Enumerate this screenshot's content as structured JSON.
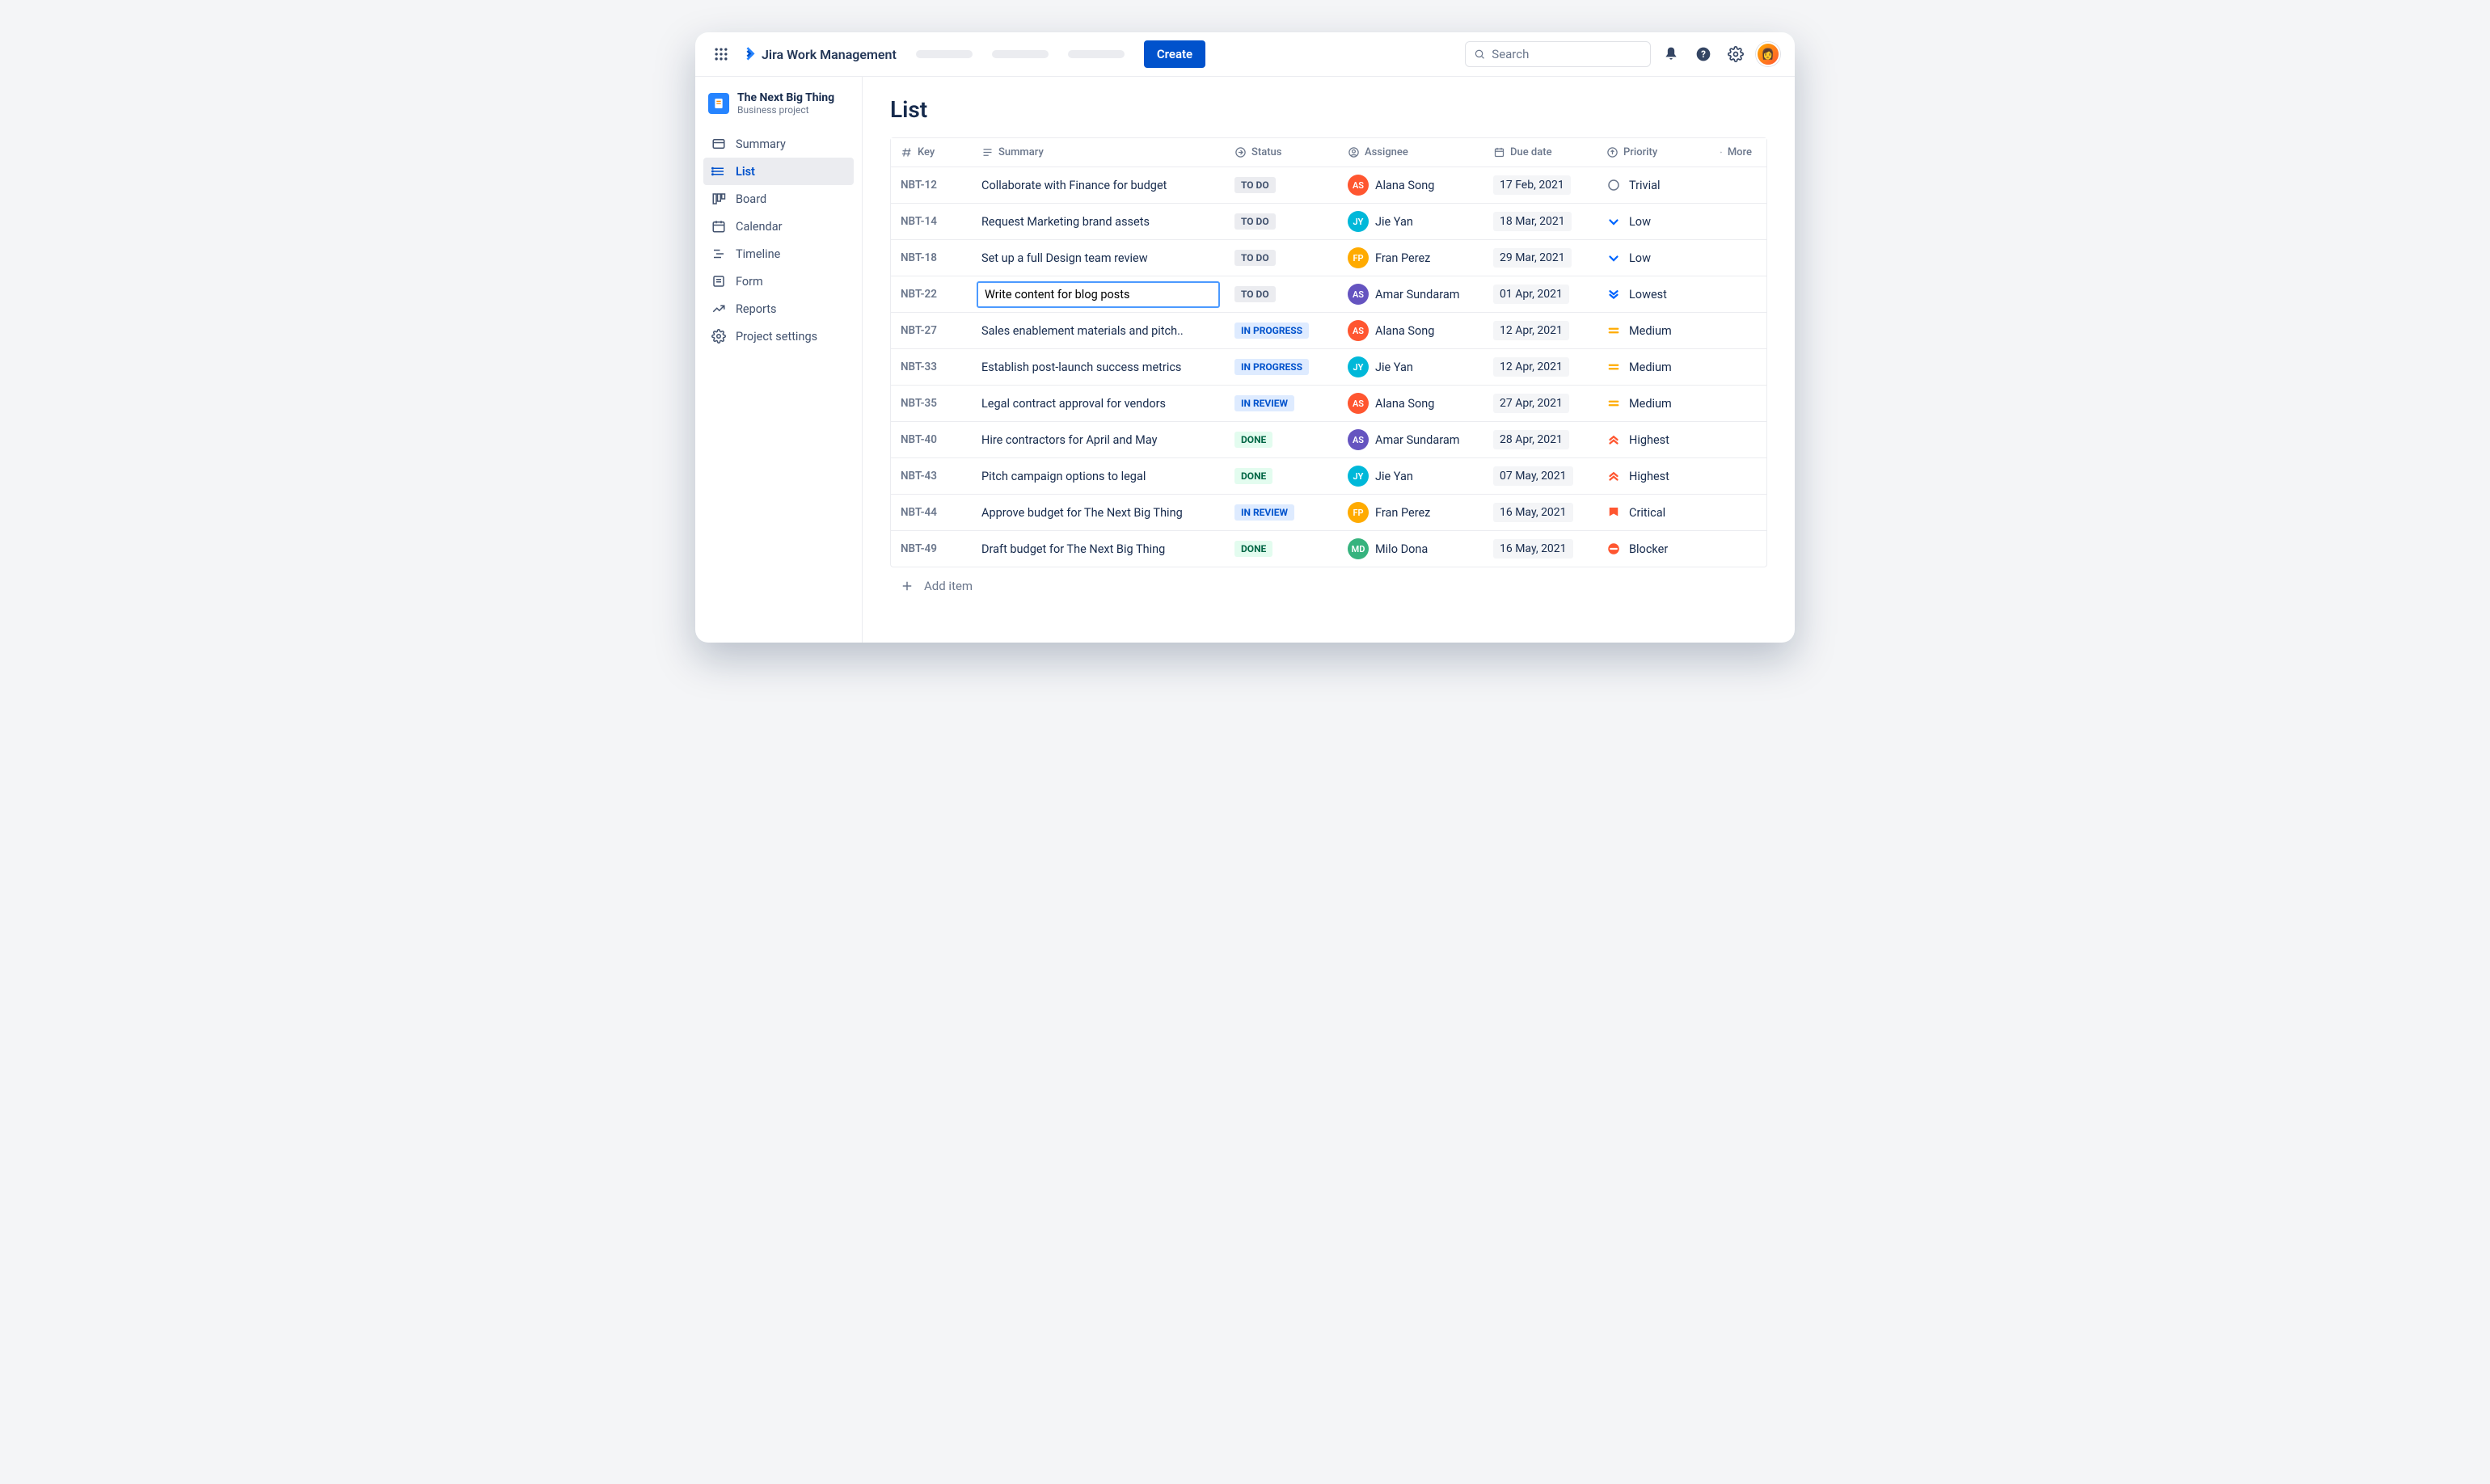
{
  "header": {
    "product_name": "Jira Work Management",
    "create_label": "Create",
    "search_placeholder": "Search"
  },
  "project": {
    "name": "The Next Big Thing",
    "type": "Business project"
  },
  "sidebar": {
    "items": [
      {
        "label": "Summary"
      },
      {
        "label": "List"
      },
      {
        "label": "Board"
      },
      {
        "label": "Calendar"
      },
      {
        "label": "Timeline"
      },
      {
        "label": "Form"
      },
      {
        "label": "Reports"
      },
      {
        "label": "Project settings"
      }
    ],
    "active_index": 1
  },
  "page": {
    "title": "List",
    "add_item_label": "Add item"
  },
  "columns": {
    "key": "Key",
    "summary": "Summary",
    "status": "Status",
    "assignee": "Assignee",
    "due": "Due date",
    "priority": "Priority",
    "more": "More"
  },
  "rows": [
    {
      "key": "NBT-12",
      "summary": "Collaborate with Finance for budget",
      "status": "TO DO",
      "status_kind": "todo",
      "assignee": "Alana Song",
      "avatar_color": "#ff5630",
      "due": "17 Feb, 2021",
      "priority": "Trivial",
      "editing": false
    },
    {
      "key": "NBT-14",
      "summary": "Request Marketing brand assets",
      "status": "TO DO",
      "status_kind": "todo",
      "assignee": "Jie Yan",
      "avatar_color": "#00b8d9",
      "due": "18 Mar, 2021",
      "priority": "Low",
      "editing": false
    },
    {
      "key": "NBT-18",
      "summary": "Set up a full Design team review",
      "status": "TO DO",
      "status_kind": "todo",
      "assignee": "Fran Perez",
      "avatar_color": "#ffab00",
      "due": "29 Mar, 2021",
      "priority": "Low",
      "editing": false
    },
    {
      "key": "NBT-22",
      "summary": "Write content for blog posts",
      "status": "TO DO",
      "status_kind": "todo",
      "assignee": "Amar Sundaram",
      "avatar_color": "#6554c0",
      "due": "01 Apr, 2021",
      "priority": "Lowest",
      "editing": true
    },
    {
      "key": "NBT-27",
      "summary": "Sales enablement materials and pitch..",
      "status": "IN PROGRESS",
      "status_kind": "progress",
      "assignee": "Alana Song",
      "avatar_color": "#ff5630",
      "due": "12 Apr, 2021",
      "priority": "Medium",
      "editing": false
    },
    {
      "key": "NBT-33",
      "summary": "Establish post-launch success metrics",
      "status": "IN PROGRESS",
      "status_kind": "progress",
      "assignee": "Jie Yan",
      "avatar_color": "#00b8d9",
      "due": "12 Apr, 2021",
      "priority": "Medium",
      "editing": false
    },
    {
      "key": "NBT-35",
      "summary": "Legal contract approval for vendors",
      "status": "IN REVIEW",
      "status_kind": "review",
      "assignee": "Alana Song",
      "avatar_color": "#ff5630",
      "due": "27 Apr, 2021",
      "priority": "Medium",
      "editing": false
    },
    {
      "key": "NBT-40",
      "summary": "Hire contractors for April and May",
      "status": "DONE",
      "status_kind": "done",
      "assignee": "Amar Sundaram",
      "avatar_color": "#6554c0",
      "due": "28 Apr, 2021",
      "priority": "Highest",
      "editing": false
    },
    {
      "key": "NBT-43",
      "summary": "Pitch campaign options to legal",
      "status": "DONE",
      "status_kind": "done",
      "assignee": "Jie Yan",
      "avatar_color": "#00b8d9",
      "due": "07 May, 2021",
      "priority": "Highest",
      "editing": false
    },
    {
      "key": "NBT-44",
      "summary": "Approve budget for The Next Big Thing",
      "status": "IN REVIEW",
      "status_kind": "review",
      "assignee": "Fran Perez",
      "avatar_color": "#ffab00",
      "due": "16 May, 2021",
      "priority": "Critical",
      "editing": false
    },
    {
      "key": "NBT-49",
      "summary": "Draft budget for The Next Big Thing",
      "status": "DONE",
      "status_kind": "done",
      "assignee": "Milo Dona",
      "avatar_color": "#36b37e",
      "due": "16 May, 2021",
      "priority": "Blocker",
      "editing": false
    }
  ]
}
